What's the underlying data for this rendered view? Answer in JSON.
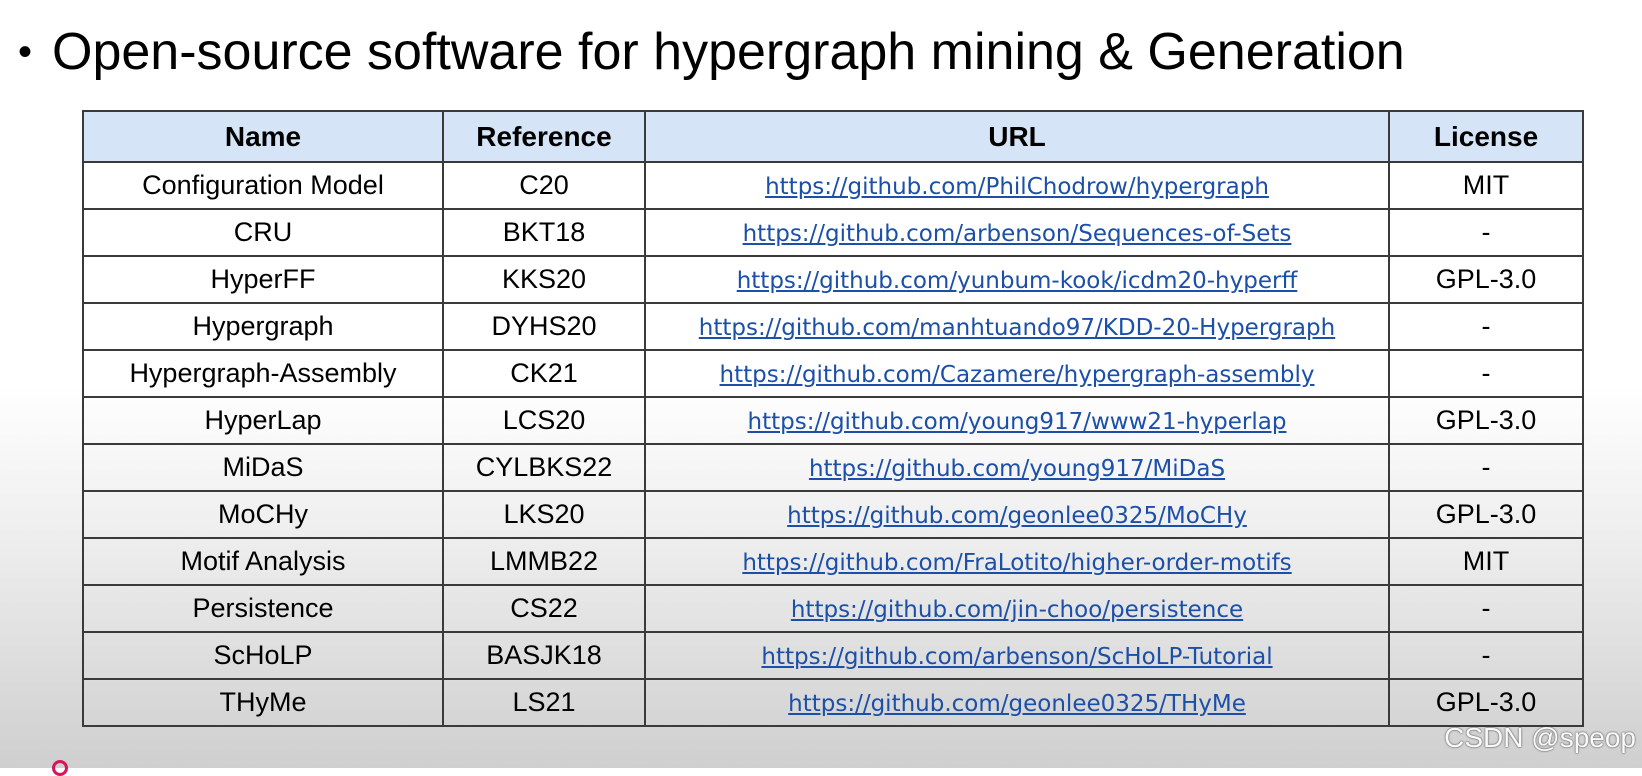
{
  "title": {
    "bullet": "•",
    "text": "Open-source software for hypergraph mining & Generation"
  },
  "table": {
    "headers": [
      "Name",
      "Reference",
      "URL",
      "License"
    ],
    "rows": [
      {
        "name": "Configuration Model",
        "reference": "C20",
        "url": "https://github.com/PhilChodrow/hypergraph",
        "license": "MIT"
      },
      {
        "name": "CRU",
        "reference": "BKT18",
        "url": "https://github.com/arbenson/Sequences-of-Sets",
        "license": "-"
      },
      {
        "name": "HyperFF",
        "reference": "KKS20",
        "url": "https://github.com/yunbum-kook/icdm20-hyperff",
        "license": "GPL-3.0"
      },
      {
        "name": "Hypergraph",
        "reference": "DYHS20",
        "url": "https://github.com/manhtuando97/KDD-20-Hypergraph",
        "license": "-"
      },
      {
        "name": "Hypergraph-Assembly",
        "reference": "CK21",
        "url": "https://github.com/Cazamere/hypergraph-assembly",
        "license": "-"
      },
      {
        "name": "HyperLap",
        "reference": "LCS20",
        "url": "https://github.com/young917/www21-hyperlap",
        "license": "GPL-3.0"
      },
      {
        "name": "MiDaS",
        "reference": "CYLBKS22",
        "url": "https://github.com/young917/MiDaS",
        "license": "-"
      },
      {
        "name": "MoCHy",
        "reference": "LKS20",
        "url": "https://github.com/geonlee0325/MoCHy",
        "license": "GPL-3.0"
      },
      {
        "name": "Motif Analysis",
        "reference": "LMMB22",
        "url": "https://github.com/FraLotito/higher-order-motifs",
        "license": "MIT"
      },
      {
        "name": "Persistence",
        "reference": "CS22",
        "url": "https://github.com/jin-choo/persistence",
        "license": "-"
      },
      {
        "name": "ScHoLP",
        "reference": "BASJK18",
        "url": "https://github.com/arbenson/ScHoLP-Tutorial",
        "license": "-"
      },
      {
        "name": "THyMe",
        "reference": "LS21",
        "url": "https://github.com/geonlee0325/THyMe",
        "license": "GPL-3.0"
      }
    ]
  },
  "watermark": "CSDN @speop",
  "colors": {
    "header_bg": "#d6e4f7",
    "link": "#1b4fa8",
    "accent": "#d8145c"
  }
}
